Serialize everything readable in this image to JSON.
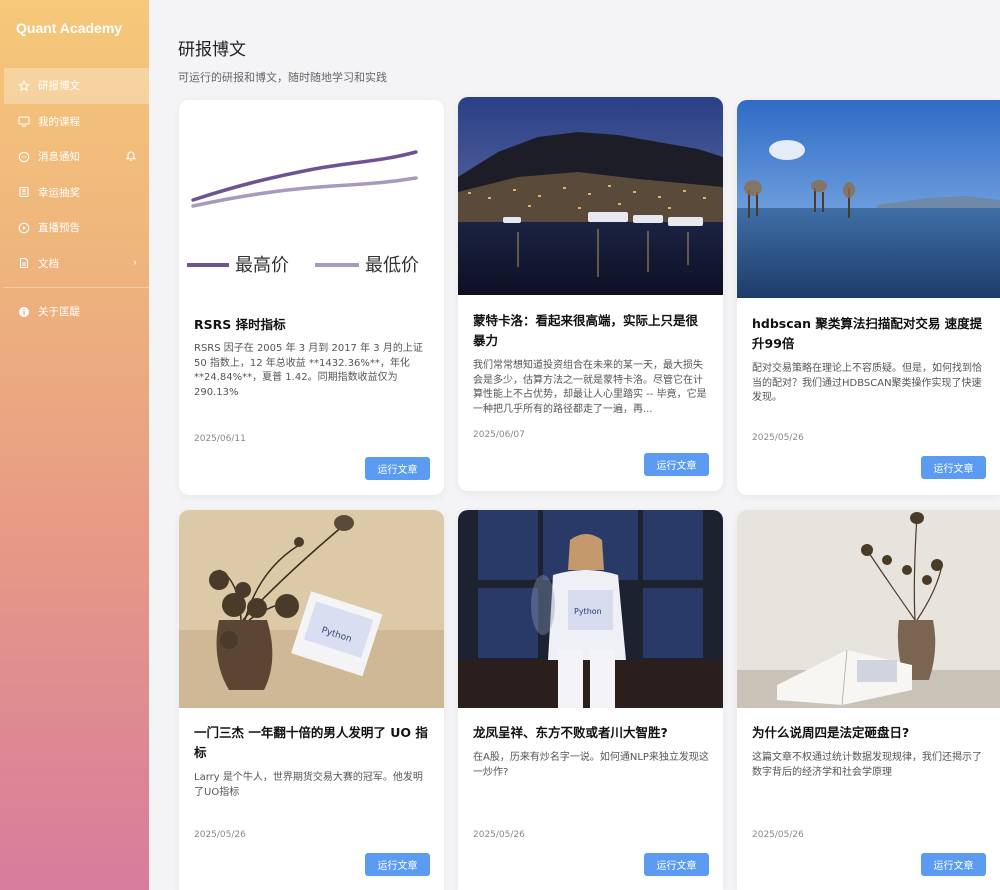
{
  "brand": "Quant Academy",
  "nav": [
    {
      "label": "研报博文",
      "icon": "star-icon",
      "active": true
    },
    {
      "label": "我的课程",
      "icon": "monitor-icon"
    },
    {
      "label": "消息通知",
      "icon": "chat-icon",
      "right_icon": "bell-icon"
    },
    {
      "label": "幸运抽奖",
      "icon": "ticket-icon"
    },
    {
      "label": "直播预告",
      "icon": "play-icon"
    },
    {
      "label": "文档",
      "icon": "document-icon",
      "right_icon": "chevron-right-icon"
    },
    {
      "label": "关于匡醍",
      "icon": "info-icon"
    }
  ],
  "page": {
    "title": "研报博文",
    "subtitle": "可运行的研报和博文，随时随地学习和实践"
  },
  "cards": [
    {
      "image": "rsrs-chart",
      "image_legend": [
        "最高价",
        "最低价"
      ],
      "title": "RSRS 择时指标",
      "desc": "RSRS 因子在 2005 年 3 月到 2017 年 3 月的上证 50 指数上，12 年总收益 **1432.36%**，年化 **24.84%**，夏普 1.42。同期指数收益仅为 290.13%",
      "date": "2025/06/11",
      "button": "运行文章"
    },
    {
      "image": "monaco-night-photo",
      "title": "蒙特卡洛：看起来很高端，实际上只是很暴力",
      "desc": "我们常常想知道投资组合在未来的某一天，最大损失会是多少，估算方法之一就是蒙特卡洛。尽管它在计算性能上不占优势，却最让人心里踏实 -- 毕竟，它是一种把几乎所有的路径都走了一遍，再...",
      "date": "2025/06/07",
      "button": "运行文章"
    },
    {
      "image": "lake-trees-photo",
      "title": "hdbscan 聚类算法扫描配对交易 速度提升99倍",
      "desc": "配对交易策略在理论上不容质疑。但是，如何找到恰当的配对？我们通过HDBSCAN聚类操作实现了快速发现。",
      "date": "2025/05/26",
      "button": "运行文章"
    },
    {
      "image": "lotus-book-photo",
      "title": "一门三杰 一年翻十倍的男人发明了 UO 指标",
      "desc": "Larry 是个牛人，世界期货交易大赛的冠军。他发明了UO指标",
      "date": "2025/05/26",
      "button": "运行文章"
    },
    {
      "image": "model-python-book-photo",
      "title": "龙凤呈祥、东方不败或者川大智胜?",
      "desc": "在A股，历来有炒名字一说。如何通NLP来独立发现这一炒作?",
      "date": "2025/05/26",
      "button": "运行文章"
    },
    {
      "image": "vase-open-book-photo",
      "title": "为什么说周四是法定砸盘日?",
      "desc": "这篇文章不权通过统计数据发现规律，我们还揭示了数字背后的经济学和社会学原理",
      "date": "2025/05/26",
      "button": "运行文章"
    }
  ],
  "colors": {
    "accent": "#5b9cf2",
    "sidebar_top": "#f6c879",
    "sidebar_bottom": "#d77c9d",
    "chart_high": "#6e5394",
    "chart_low": "#a79abf"
  }
}
